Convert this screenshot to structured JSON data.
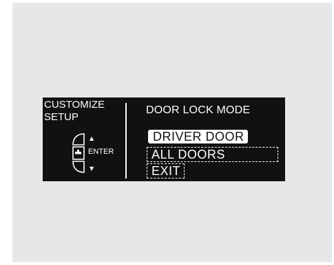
{
  "display": {
    "left_title_line1": "CUSTOMIZE",
    "left_title_line2": "SETUP",
    "enter_label": "ENTER",
    "up_arrow": "▲",
    "down_arrow": "▼",
    "heading": "DOOR LOCK MODE",
    "options": [
      {
        "label": "DRIVER DOOR",
        "state": "selected"
      },
      {
        "label": "ALL DOORS",
        "state": "dashed"
      },
      {
        "label": "EXIT",
        "state": "dashed"
      }
    ]
  },
  "colors": {
    "background_frame": "#e6e7e8",
    "display_background": "#111111",
    "display_text": "#ffffff"
  },
  "icons": {
    "selector_knob": "selector-knob-icon"
  }
}
